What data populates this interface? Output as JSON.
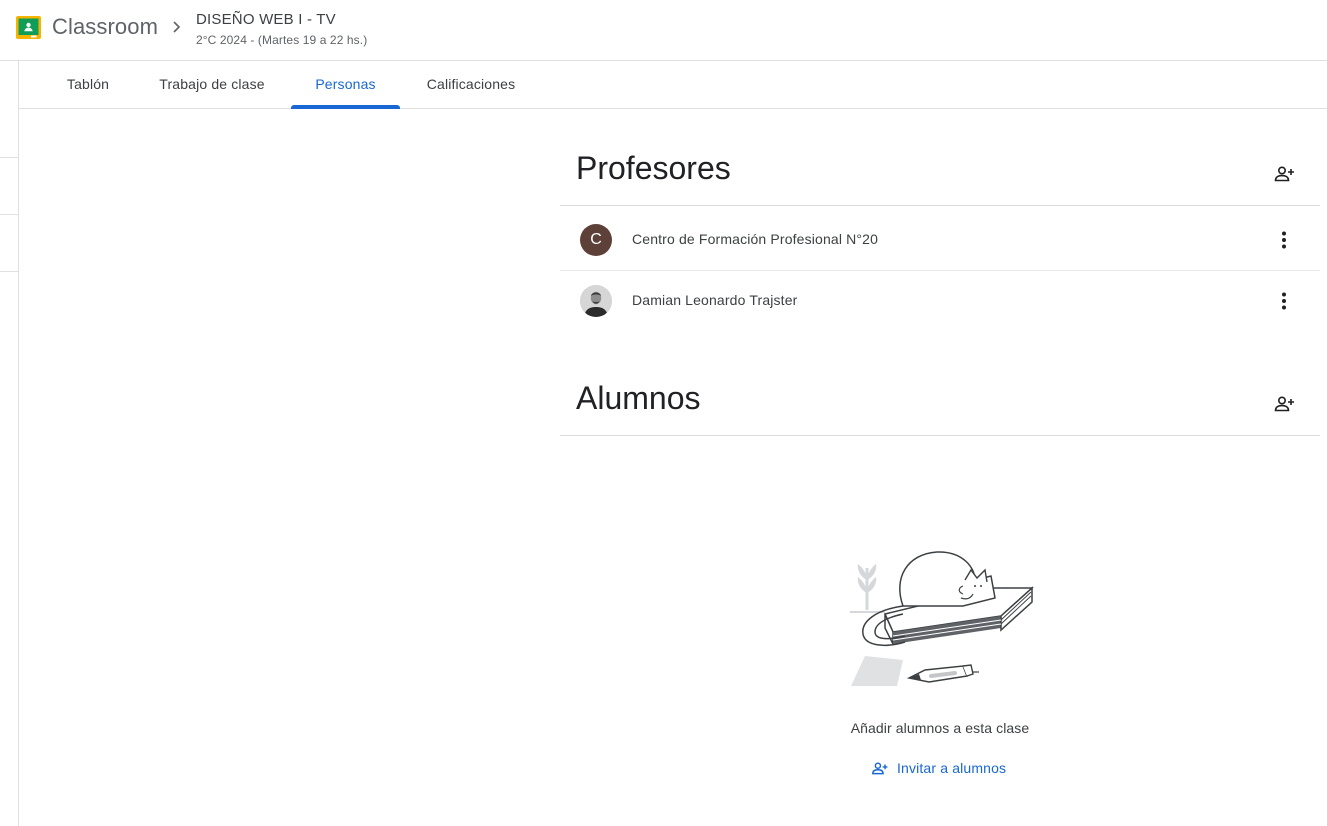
{
  "header": {
    "app_title": "Classroom",
    "class_name": "DISEÑO WEB I - TV",
    "class_section": "2°C 2024 - (Martes 19 a 22 hs.)"
  },
  "tabs": [
    {
      "label": "Tablón",
      "active": false
    },
    {
      "label": "Trabajo de clase",
      "active": false
    },
    {
      "label": "Personas",
      "active": true
    },
    {
      "label": "Calificaciones",
      "active": false
    }
  ],
  "teachers": {
    "title": "Profesores",
    "people": [
      {
        "name": "Centro de Formación Profesional N°20",
        "avatar_initial": "C",
        "avatar_color": "#5d4037"
      },
      {
        "name": "Damian Leonardo Trajster",
        "avatar_initial": "",
        "avatar_color": "#bdbdbd"
      }
    ]
  },
  "students": {
    "title": "Alumnos",
    "empty_message": "Añadir alumnos a esta clase",
    "invite_label": "Invitar a alumnos"
  },
  "colors": {
    "accent": "#1967d2",
    "logo_green": "#0f9d58",
    "logo_yellow": "#f4b400",
    "divider": "#dadce0"
  },
  "icons": {
    "logo": "classroom-logo",
    "breadcrumb": "chevron-right-icon",
    "add_person": "person-add-icon",
    "more": "more-vert-icon"
  }
}
